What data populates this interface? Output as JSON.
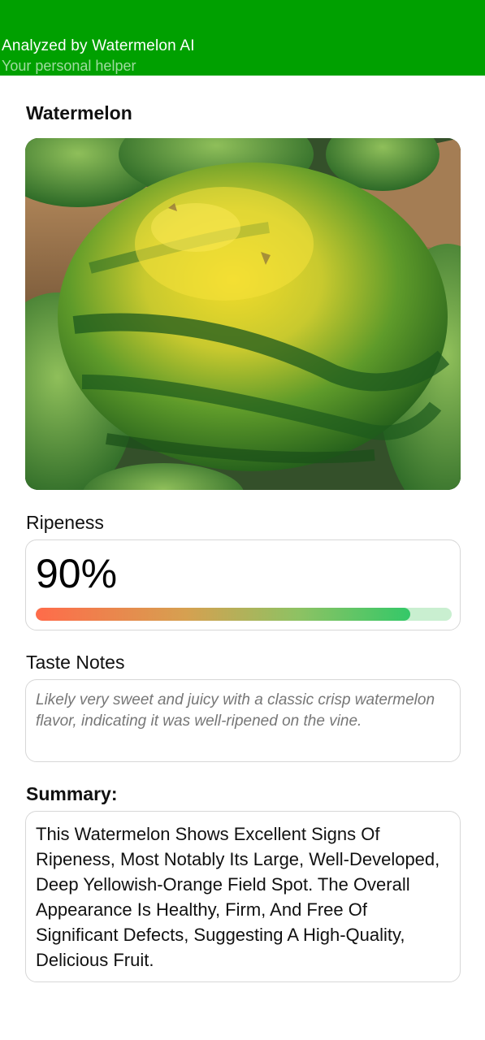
{
  "header": {
    "title": "Analyzed by Watermelon AI",
    "subtitle": "Your personal helper",
    "background_color": "#00a000"
  },
  "page": {
    "title": "Watermelon"
  },
  "ripeness": {
    "label": "Ripeness",
    "value_text": "90%",
    "value": 90
  },
  "taste": {
    "label": "Taste Notes",
    "text": "Likely very sweet and juicy with a classic crisp watermelon flavor, indicating it was well-ripened on the vine."
  },
  "summary": {
    "label": "Summary:",
    "text": "This Watermelon Shows Excellent Signs Of Ripeness, Most Notably Its Large, Well-Developed, Deep Yellowish-Orange Field Spot. The Overall Appearance Is Healthy, Firm, And Free Of Significant Defects, Suggesting A High-Quality, Delicious Fruit."
  }
}
